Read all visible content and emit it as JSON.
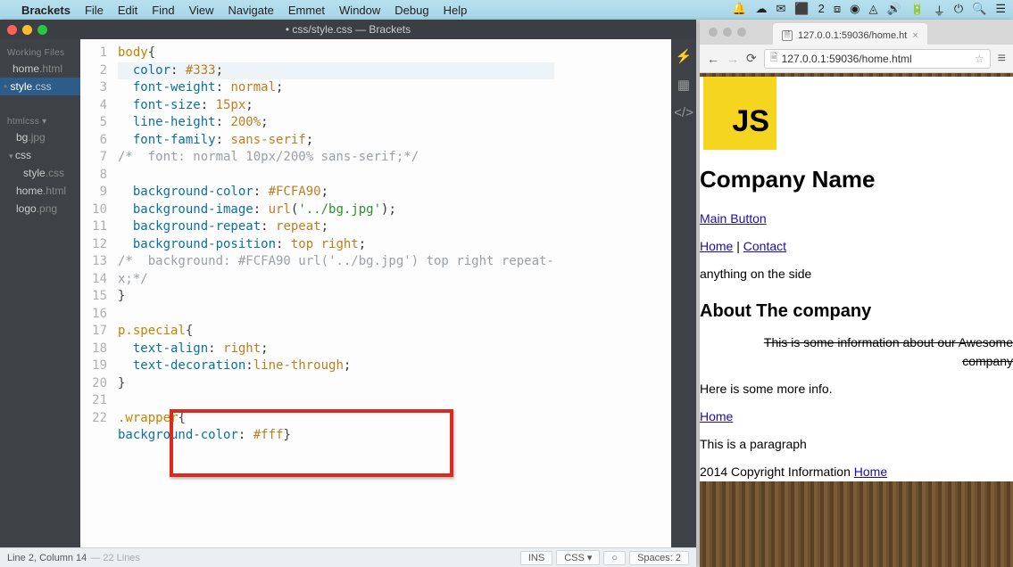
{
  "menubar": {
    "items": [
      "Brackets",
      "File",
      "Edit",
      "Find",
      "View",
      "Navigate",
      "Emmet",
      "Window",
      "Debug",
      "Help"
    ]
  },
  "editor": {
    "title": "• css/style.css — Brackets",
    "workingFilesLabel": "Working Files",
    "workingFiles": [
      {
        "name": "home",
        "ext": ".html"
      },
      {
        "name": "style",
        "ext": ".css"
      }
    ],
    "projectLabel": "htmlcss",
    "tree": [
      {
        "name": "bg",
        "ext": ".jpg",
        "indent": 1
      },
      {
        "name": "css",
        "ext": "",
        "indent": 0,
        "folder": true
      },
      {
        "name": "style",
        "ext": ".css",
        "indent": 1
      },
      {
        "name": "home",
        "ext": ".html",
        "indent": 1
      },
      {
        "name": "logo",
        "ext": ".png",
        "indent": 1
      }
    ],
    "code": [
      {
        "n": 1,
        "html": "<span class='tok-sel'>body</span><span class='tok-punc'>{</span>"
      },
      {
        "n": 2,
        "html": "  <span class='tok-prop'>color</span>: <span class='tok-val'>#333</span>;",
        "active": true
      },
      {
        "n": 3,
        "html": "  <span class='tok-prop'>font-weight</span>: <span class='tok-val'>normal</span>;"
      },
      {
        "n": 4,
        "html": "  <span class='tok-prop'>font-size</span>: <span class='tok-val'>15px</span>;"
      },
      {
        "n": 5,
        "html": "  <span class='tok-prop'>line-height</span>: <span class='tok-val'>200%</span>;"
      },
      {
        "n": 6,
        "html": "  <span class='tok-prop'>font-family</span>: <span class='tok-val'>sans-serif</span>;"
      },
      {
        "n": 7,
        "html": "<span class='tok-comm'>/*  font: normal 10px/200% sans-serif;*/</span>"
      },
      {
        "n": 8,
        "html": " "
      },
      {
        "n": 9,
        "html": "  <span class='tok-prop'>background-color</span>: <span class='tok-val'>#FCFA90</span>;"
      },
      {
        "n": 10,
        "html": "  <span class='tok-prop'>background-image</span>: <span class='tok-val'>url</span>(<span class='tok-str'>'../bg.jpg'</span>);"
      },
      {
        "n": 11,
        "html": "  <span class='tok-prop'>background-repeat</span>: <span class='tok-val'>repeat</span>;"
      },
      {
        "n": 12,
        "html": "  <span class='tok-prop'>background-position</span>: <span class='tok-val'>top</span> <span class='tok-val'>right</span>;"
      },
      {
        "n": 13,
        "html": "<span class='tok-comm'>/*  background: #FCFA90 url('../bg.jpg') top right repeat-</span>"
      },
      {
        "n": "",
        "html": "<span class='tok-comm'>x;*/</span>"
      },
      {
        "n": 14,
        "html": "<span class='tok-punc'>}</span>"
      },
      {
        "n": 15,
        "html": " "
      },
      {
        "n": 16,
        "html": "<span class='tok-sel'>p.special</span><span class='tok-punc'>{</span>"
      },
      {
        "n": 17,
        "html": "  <span class='tok-prop'>text-align</span>: <span class='tok-val'>right</span>;"
      },
      {
        "n": 18,
        "html": "  <span class='tok-prop'>text-decoration</span>:<span class='tok-val'>line-through</span>;"
      },
      {
        "n": 19,
        "html": "<span class='tok-punc'>}</span>"
      },
      {
        "n": 20,
        "html": " "
      },
      {
        "n": 21,
        "html": "<span class='tok-sel'>.wrapper</span><span class='tok-punc'>{</span>"
      },
      {
        "n": 22,
        "html": "<span class='tok-prop'>background-color</span>: <span class='tok-val'>#fff</span><span class='tok-punc'>}</span>"
      }
    ],
    "status": {
      "pos": "Line 2, Column 14",
      "lines": "— 22 Lines",
      "ins": "INS",
      "lang": "CSS ▾",
      "circle": "○",
      "spaces": "Spaces: 2"
    }
  },
  "browser": {
    "tabTitle": "127.0.0.1:59036/home.ht",
    "url": "127.0.0.1:59036/home.html",
    "page": {
      "logoText": "JS",
      "h1": "Company Name",
      "btn": "Main Button",
      "navHome": "Home",
      "navSep": " | ",
      "navContact": "Contact",
      "aside": "anything on the side",
      "h2": "About The company",
      "strike": "This is some information about our Awesome company",
      "more": "Here is some more info.",
      "homeLink": "Home",
      "para": "This is a paragraph",
      "footerText": "2014 Copyright Information ",
      "footerLink": "Home"
    }
  }
}
